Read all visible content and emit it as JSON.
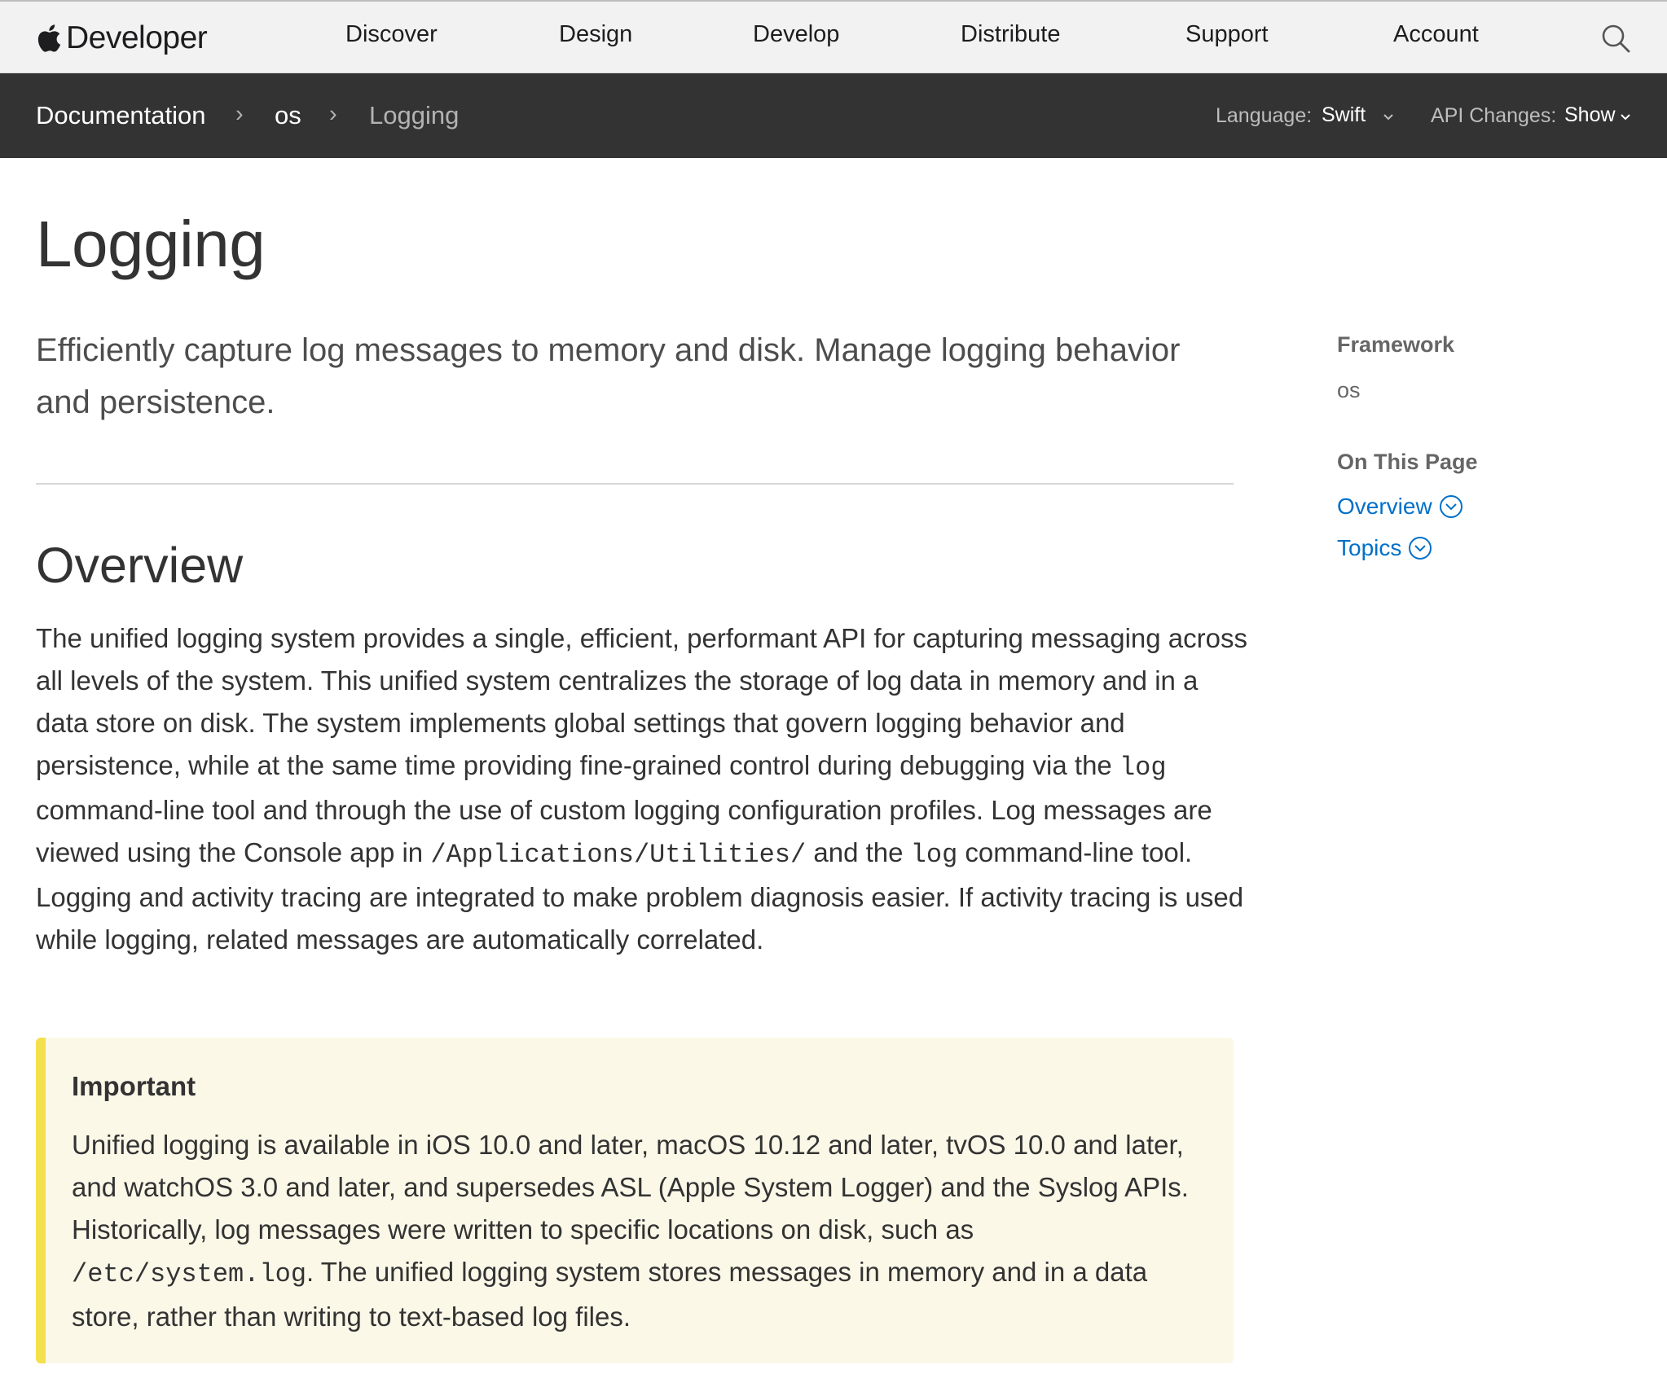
{
  "global_nav": {
    "brand": "Developer",
    "items": [
      "Discover",
      "Design",
      "Develop",
      "Distribute",
      "Support",
      "Account"
    ],
    "search_icon": "search-icon"
  },
  "local_nav": {
    "breadcrumbs": [
      "Documentation",
      "os",
      "Logging"
    ],
    "separator": "›",
    "language_label": "Language:",
    "language_value": "Swift",
    "api_changes_label": "API Changes:",
    "api_changes_value": "Show"
  },
  "main": {
    "title": "Logging",
    "abstract": "Efficiently capture log messages to memory and disk. Manage logging behavior and persistence.",
    "overview_heading": "Overview",
    "overview": {
      "t1": "The unified logging system provides a single, efficient, performant API for capturing messaging across all levels of the system. This unified system centralizes the storage of log data in memory and in a data store on disk. The system implements global settings that govern logging behavior and persistence, while at the same time providing fine-grained control during debugging via the ",
      "c1": "log",
      "t2": " command-line tool and through the use of custom logging configuration profiles. Log messages are viewed using the Console app in ",
      "c2": "/Applications/Utilities/",
      "t3": " and the ",
      "c3": "log",
      "t4": " command-line tool. Logging and activity tracing are integrated to make problem diagnosis easier. If activity tracing is used while logging, related messages are automatically correlated."
    },
    "important": {
      "label": "Important",
      "t1": "Unified logging is available in iOS 10.0 and later, macOS 10.12 and later, tvOS 10.0 and later, and watchOS 3.0 and later, and supersedes ASL (Apple System Logger) and the Syslog APIs. Historically, log messages were written to specific locations on disk, such as ",
      "c1": "/etc/system.log",
      "t2": ". The unified logging system stores messages in memory and in a data store, rather than writing to text-based log files."
    }
  },
  "sidebar": {
    "framework_label": "Framework",
    "framework_value": "os",
    "on_this_page_label": "On This Page",
    "links": [
      "Overview",
      "Topics"
    ],
    "link_icon": "chevron-circle-down-icon"
  },
  "colors": {
    "link": "#0070c9",
    "local_nav_bg": "#333333",
    "global_nav_bg": "#f2f2f2",
    "aside_bg": "#fbf8e8",
    "aside_border": "#f4e04d"
  }
}
